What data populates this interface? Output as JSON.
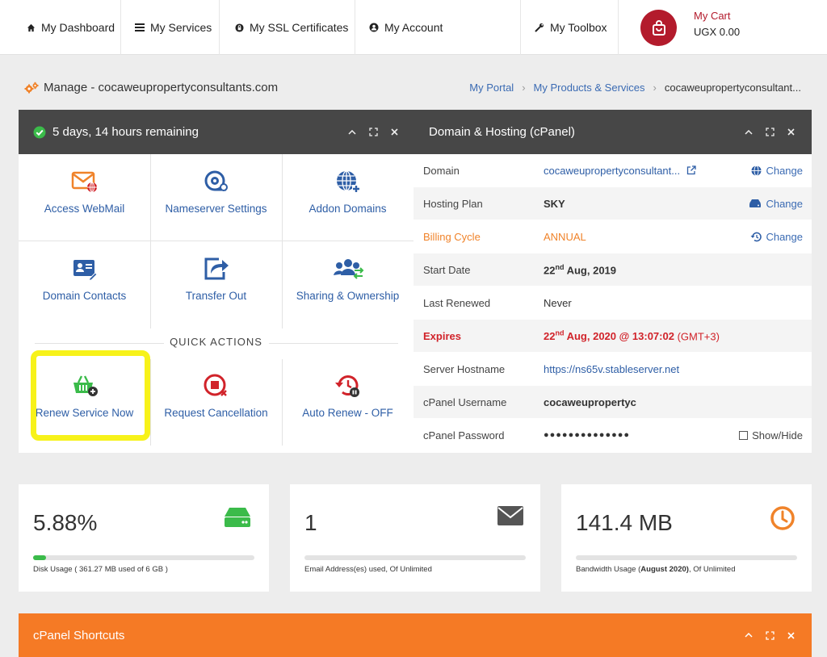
{
  "nav": {
    "items": [
      {
        "label": "My Dashboard",
        "icon": "home-icon"
      },
      {
        "label": "My Services",
        "icon": "list-icon"
      },
      {
        "label": "My SSL Certificates",
        "icon": "lock-icon"
      },
      {
        "label": "My Account",
        "icon": "user-icon"
      },
      {
        "label": "My Toolbox",
        "icon": "wrench-icon"
      }
    ],
    "cart": {
      "title": "My Cart",
      "amount": "UGX 0.00"
    }
  },
  "header": {
    "title": "Manage - cocaweupropertyconsultants.com",
    "breadcrumb": [
      "My Portal",
      "My Products & Services",
      "cocaweupropertyconsultant..."
    ]
  },
  "left_panel": {
    "title": "5 days, 14 hours remaining",
    "actions": [
      {
        "label": "Access WebMail",
        "icon": "webmail-icon"
      },
      {
        "label": "Nameserver Settings",
        "icon": "nameserver-icon"
      },
      {
        "label": "Addon Domains",
        "icon": "addon-domains-icon"
      },
      {
        "label": "Domain Contacts",
        "icon": "contacts-icon"
      },
      {
        "label": "Transfer Out",
        "icon": "transfer-out-icon"
      },
      {
        "label": "Sharing & Ownership",
        "icon": "sharing-icon"
      }
    ],
    "quick_actions_label": "QUICK ACTIONS",
    "quick_actions": [
      {
        "label": "Renew Service Now",
        "icon": "renew-basket-icon"
      },
      {
        "label": "Request Cancellation",
        "icon": "cancel-icon"
      },
      {
        "label": "Auto Renew - OFF",
        "icon": "auto-renew-icon"
      }
    ]
  },
  "right_panel": {
    "title": "Domain & Hosting (cPanel)",
    "rows": [
      {
        "label": "Domain",
        "value": "cocaweupropertyconsultant...",
        "action": "Change"
      },
      {
        "label": "Hosting Plan",
        "value": "SKY",
        "action": "Change"
      },
      {
        "label": "Billing Cycle",
        "value": "ANNUAL",
        "action": "Change"
      },
      {
        "label": "Start Date",
        "value_day": "22",
        "value_sup": "nd",
        "value_rest": " Aug, 2019"
      },
      {
        "label": "Last Renewed",
        "value": "Never"
      },
      {
        "label": "Expires",
        "value_day": "22",
        "value_sup": "nd",
        "value_rest": " Aug, 2020 @ 13:07:02",
        "value_tz": " (GMT+3)"
      },
      {
        "label": "Server Hostname",
        "value": "https://ns65v.stableserver.net"
      },
      {
        "label": "cPanel Username",
        "value": "cocaweupropertyc"
      },
      {
        "label": "cPanel Password",
        "value": "●●●●●●●●●●●●●●",
        "action": "Show/Hide"
      }
    ]
  },
  "stats": [
    {
      "value": "5.88%",
      "note": "Disk Usage ( 361.27 MB used of 6 GB )",
      "progress": 0.0588,
      "icon": "disk-icon"
    },
    {
      "value": "1",
      "note": "Email Address(es) used, Of Unlimited",
      "progress": 0,
      "icon": "envelope-icon"
    },
    {
      "value": "141.4 MB",
      "note_pre": "Bandwidth Usage (",
      "note_bold": "August 2020)",
      "note_post": ", Of Unlimited",
      "progress": 0,
      "icon": "clock-icon"
    }
  ],
  "shortcuts": {
    "title": "cPanel Shortcuts"
  },
  "colors": {
    "accent_red": "#b31b2c",
    "link_blue": "#2e5ea6",
    "orange": "#f57a25",
    "green": "#3bbb4a",
    "highlight": "#f7f21a"
  }
}
